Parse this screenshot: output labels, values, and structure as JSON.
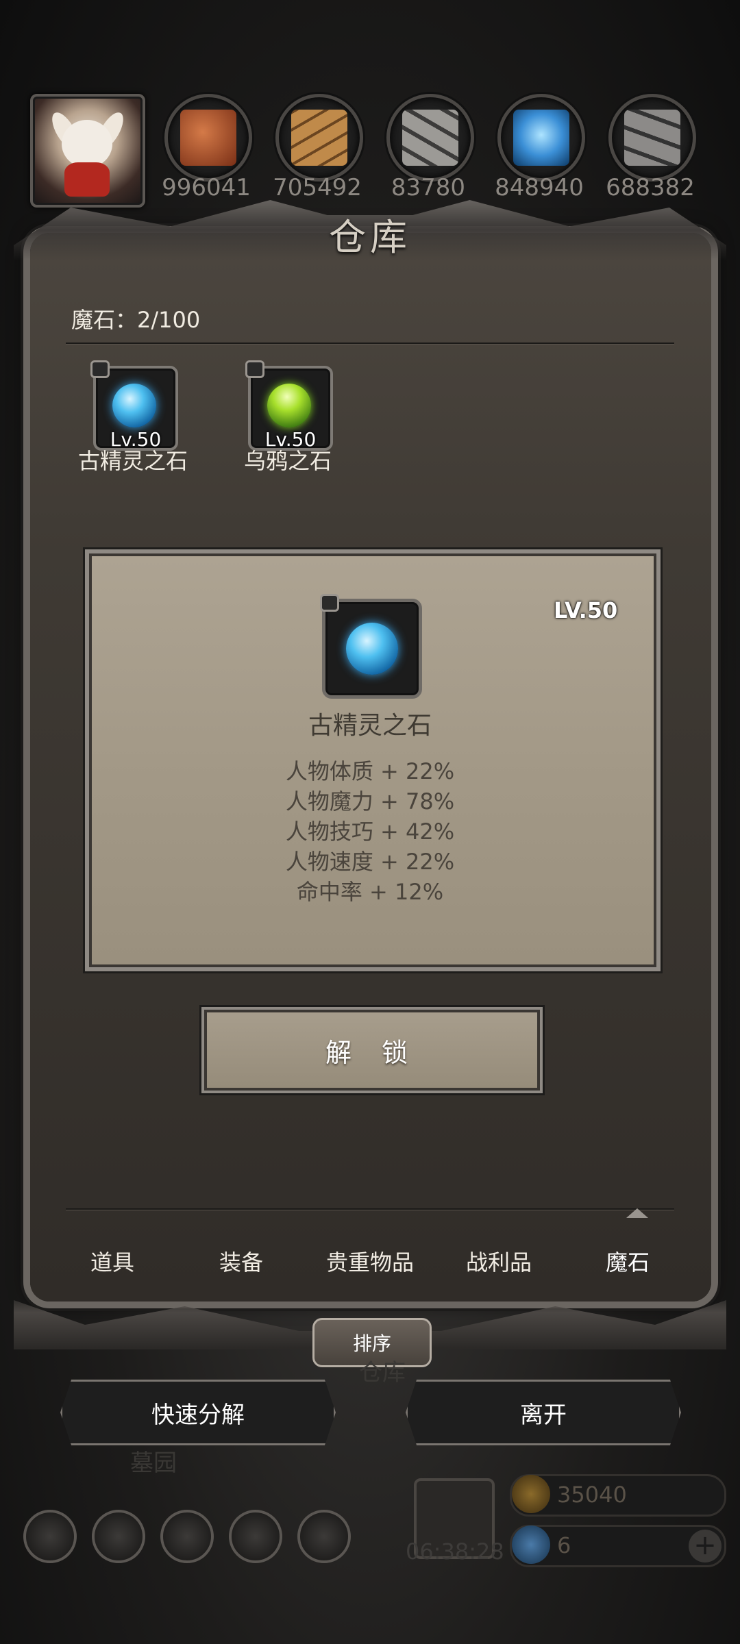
{
  "resources": [
    {
      "value": "996041",
      "icon": "meat-icon",
      "color": "#b8562c"
    },
    {
      "value": "705492",
      "icon": "wood-planks-icon",
      "color": "#a9773b"
    },
    {
      "value": "83780",
      "icon": "stone-blocks-icon",
      "color": "#8a8885"
    },
    {
      "value": "848940",
      "icon": "crystal-icon",
      "color": "#3b8fd6"
    },
    {
      "value": "688382",
      "icon": "iron-ingot-icon",
      "color": "#6e6c6a"
    }
  ],
  "panel": {
    "title": "仓库",
    "count_label": "魔石：2/100"
  },
  "stones": [
    {
      "level": "Lv.50",
      "name": "古精灵之石",
      "gem": "blue-gem-icon"
    },
    {
      "level": "Lv.50",
      "name": "乌鸦之石",
      "gem": "green-gem-icon"
    }
  ],
  "detail": {
    "level": "LV.50",
    "name": "古精灵之石",
    "stats": [
      "人物体质 + 22%",
      "人物魔力 + 78%",
      "人物技巧 + 42%",
      "人物速度 + 22%",
      "命中率 + 12%"
    ],
    "unlock_label": "解 锁"
  },
  "tabs": [
    "道具",
    "装备",
    "贵重物品",
    "战利品",
    "魔石"
  ],
  "active_tab": "魔石",
  "sort_label": "排序",
  "actions": {
    "quick_decompose": "快速分解",
    "leave": "离开"
  },
  "background": {
    "warehouse_text": "仓库",
    "cemetery_text": "墓园"
  },
  "gift_timer": "06:38:28",
  "currencies": {
    "gold": "35040",
    "gem": "6"
  }
}
